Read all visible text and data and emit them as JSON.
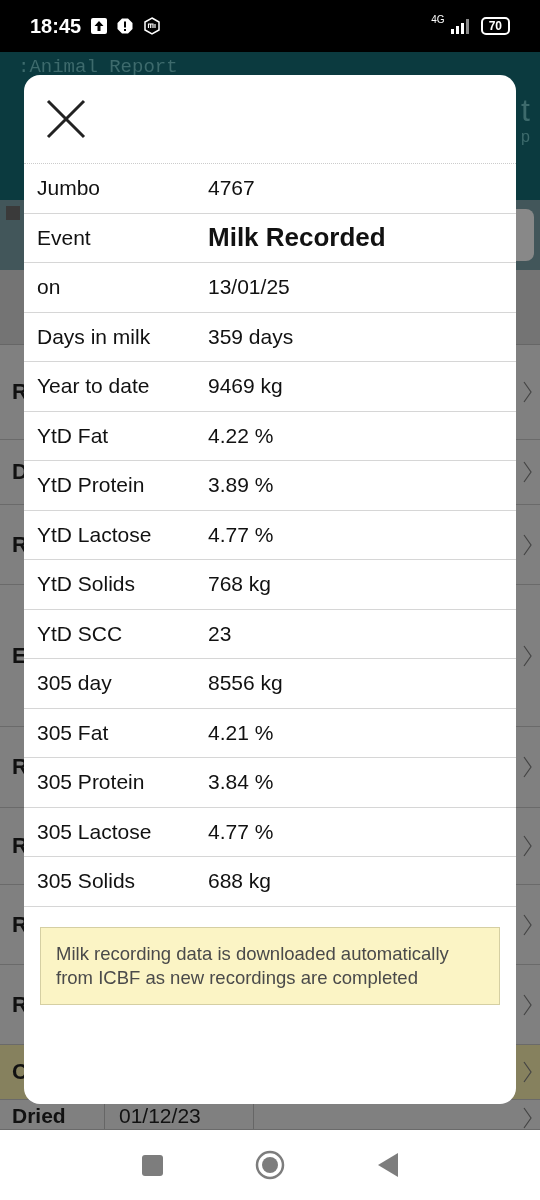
{
  "status_bar": {
    "time": "18:45",
    "network": "4G",
    "battery": "70"
  },
  "app_header": {
    "title": ":Animal Report",
    "right_fragments": [
      "t",
      "p"
    ]
  },
  "event_rows": [
    {
      "label": "R",
      "highlighted": false
    },
    {
      "label": "D",
      "highlighted": false
    },
    {
      "label": "R",
      "highlighted": false
    },
    {
      "label": "E",
      "highlighted": false
    },
    {
      "label": "R",
      "highlighted": false
    },
    {
      "label": "R",
      "highlighted": false
    },
    {
      "label": "R",
      "highlighted": false
    },
    {
      "label": "R",
      "highlighted": false
    },
    {
      "label": "C",
      "highlighted": true
    },
    {
      "label": "Dried",
      "value": "01/12/23",
      "highlighted": false
    }
  ],
  "dialog": {
    "rows": [
      {
        "label": "Jumbo",
        "value": "4767",
        "emphasis": false
      },
      {
        "label": "Event",
        "value": "Milk Recorded",
        "emphasis": true
      },
      {
        "label": "on",
        "value": "13/01/25",
        "emphasis": false
      },
      {
        "label": "Days in milk",
        "value": "359 days",
        "emphasis": false
      },
      {
        "label": "Year to date",
        "value": "9469 kg",
        "emphasis": false
      },
      {
        "label": "YtD Fat",
        "value": "4.22 %",
        "emphasis": false
      },
      {
        "label": "YtD Protein",
        "value": "3.89 %",
        "emphasis": false
      },
      {
        "label": "YtD Lactose",
        "value": "4.77 %",
        "emphasis": false
      },
      {
        "label": "YtD Solids",
        "value": "768 kg",
        "emphasis": false
      },
      {
        "label": "YtD SCC",
        "value": "23",
        "emphasis": false
      },
      {
        "label": "305 day",
        "value": "8556 kg",
        "emphasis": false
      },
      {
        "label": "305 Fat",
        "value": "4.21 %",
        "emphasis": false
      },
      {
        "label": "305 Protein",
        "value": "3.84 %",
        "emphasis": false
      },
      {
        "label": "305 Lactose",
        "value": "4.77 %",
        "emphasis": false
      },
      {
        "label": "305 Solids",
        "value": "688 kg",
        "emphasis": false
      }
    ],
    "note": "Milk recording data is downloaded automatically from ICBF as new recordings are completed"
  }
}
